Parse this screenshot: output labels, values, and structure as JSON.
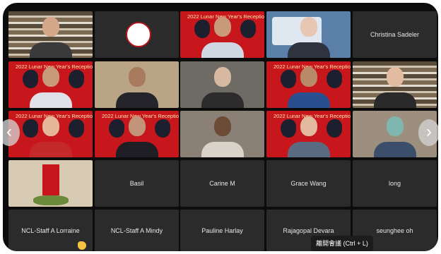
{
  "reception_banner": "2022 Lunar New Year's Reception",
  "tiles": {
    "christina": "Christina Sadeler",
    "basil": "Basil",
    "carine": "Carine M",
    "grace": "Grace Wang",
    "long": "long",
    "lorraine": "NCL-Staff A Lorraine",
    "mindy": "NCL-Staff A Mindy",
    "pauline": "Pauline Harlay",
    "rajagopal": "Rajagopal Devara",
    "seunghee": "seunghee oh"
  },
  "tooltip": "離開會議 (Ctrl + L)",
  "icons": {
    "prev": "chevron-left-icon",
    "next": "chevron-right-icon",
    "reaction": "raised-hand-icon"
  },
  "colors": {
    "stage": "#0c0c0c",
    "tile": "#2b2b2b",
    "banner_red": "#c8161d"
  }
}
